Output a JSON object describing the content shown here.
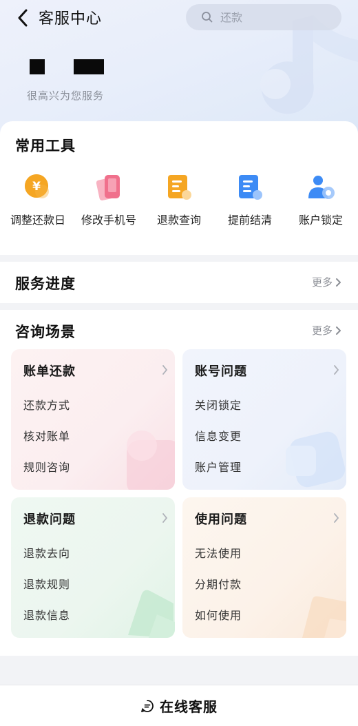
{
  "header": {
    "title": "客服中心",
    "search": {
      "placeholder": "还款"
    },
    "welcome": "很高兴为您服务"
  },
  "tools": {
    "title": "常用工具",
    "items": [
      {
        "label": "调整还款日",
        "icon": "yen-coin-icon",
        "color": "#f5a623"
      },
      {
        "label": "修改手机号",
        "icon": "phone-icon",
        "color": "#f0708c"
      },
      {
        "label": "退款查询",
        "icon": "document-search-icon",
        "color": "#f5a623"
      },
      {
        "label": "提前结清",
        "icon": "document-check-icon",
        "color": "#3d8bf5"
      },
      {
        "label": "账户锁定",
        "icon": "user-lock-icon",
        "color": "#3d8bf5"
      }
    ]
  },
  "progress": {
    "title": "服务进度",
    "more": "更多"
  },
  "consult": {
    "title": "咨询场景",
    "more": "更多",
    "tiles": [
      {
        "title": "账单还款",
        "items": [
          "还款方式",
          "核对账单",
          "规则咨询"
        ]
      },
      {
        "title": "账号问题",
        "items": [
          "关闭锁定",
          "信息变更",
          "账户管理"
        ]
      },
      {
        "title": "退款问题",
        "items": [
          "退款去向",
          "退款规则",
          "退款信息"
        ]
      },
      {
        "title": "使用问题",
        "items": [
          "无法使用",
          "分期付款",
          "如何使用"
        ]
      }
    ]
  },
  "bottom": {
    "label": "在线客服"
  },
  "colors": {
    "accent": "#3d8bf5",
    "warm": "#f5a623",
    "pink": "#f0708c"
  }
}
